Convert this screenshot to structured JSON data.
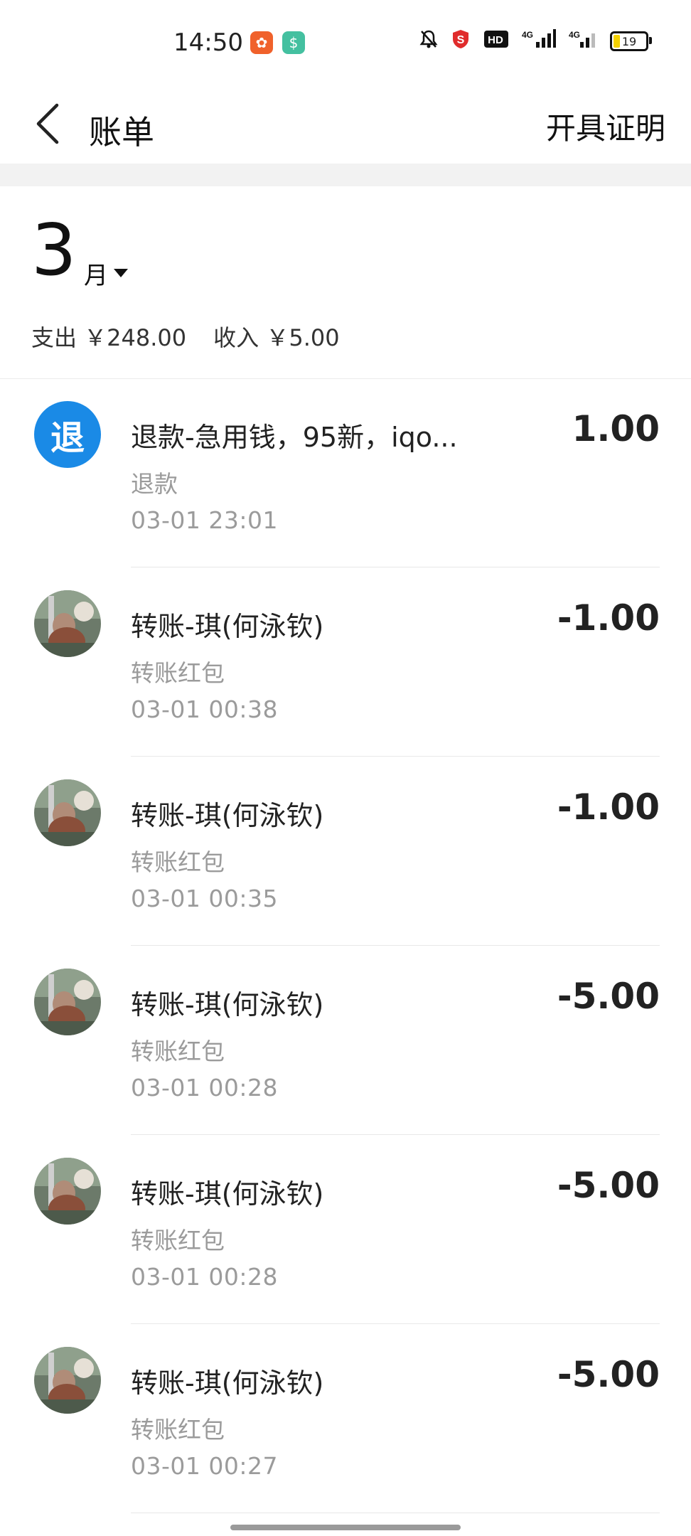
{
  "status_bar": {
    "time": "14:50",
    "apps": [
      {
        "icon": "app-icon-orange",
        "color": "#f0612b",
        "glyph": "✿"
      },
      {
        "icon": "app-icon-green",
        "color": "#44c0a0",
        "glyph": "$"
      }
    ],
    "indicators": [
      "mute-icon",
      "shield-icon",
      "hd-icon",
      "signal-4g-icon",
      "signal-4g-icon-2"
    ],
    "battery": "19"
  },
  "header": {
    "title": "账单",
    "action": "开具证明"
  },
  "month": {
    "number": "3",
    "unit": "月",
    "expense": "支出 ￥248.00",
    "income": "收入 ￥5.00"
  },
  "transactions": [
    {
      "avatar": "refund",
      "avatar_text": "退",
      "title": "退款-急用钱，95新，iqo...",
      "category": "退款",
      "time": "03-01  23:01",
      "amount": "1.00"
    },
    {
      "avatar": "photo",
      "title": "转账-琪(何泳钦)",
      "category": "转账红包",
      "time": "03-01  00:38",
      "amount": "-1.00"
    },
    {
      "avatar": "photo",
      "title": "转账-琪(何泳钦)",
      "category": "转账红包",
      "time": "03-01  00:35",
      "amount": "-1.00"
    },
    {
      "avatar": "photo",
      "title": "转账-琪(何泳钦)",
      "category": "转账红包",
      "time": "03-01  00:28",
      "amount": "-5.00"
    },
    {
      "avatar": "photo",
      "title": "转账-琪(何泳钦)",
      "category": "转账红包",
      "time": "03-01  00:28",
      "amount": "-5.00"
    },
    {
      "avatar": "photo",
      "title": "转账-琪(何泳钦)",
      "category": "转账红包",
      "time": "03-01  00:27",
      "amount": "-5.00"
    }
  ],
  "colors": {
    "refund_badge": "#1a8ae6",
    "secondary_text": "#9b9b9b",
    "divider": "#e8e8e8"
  }
}
